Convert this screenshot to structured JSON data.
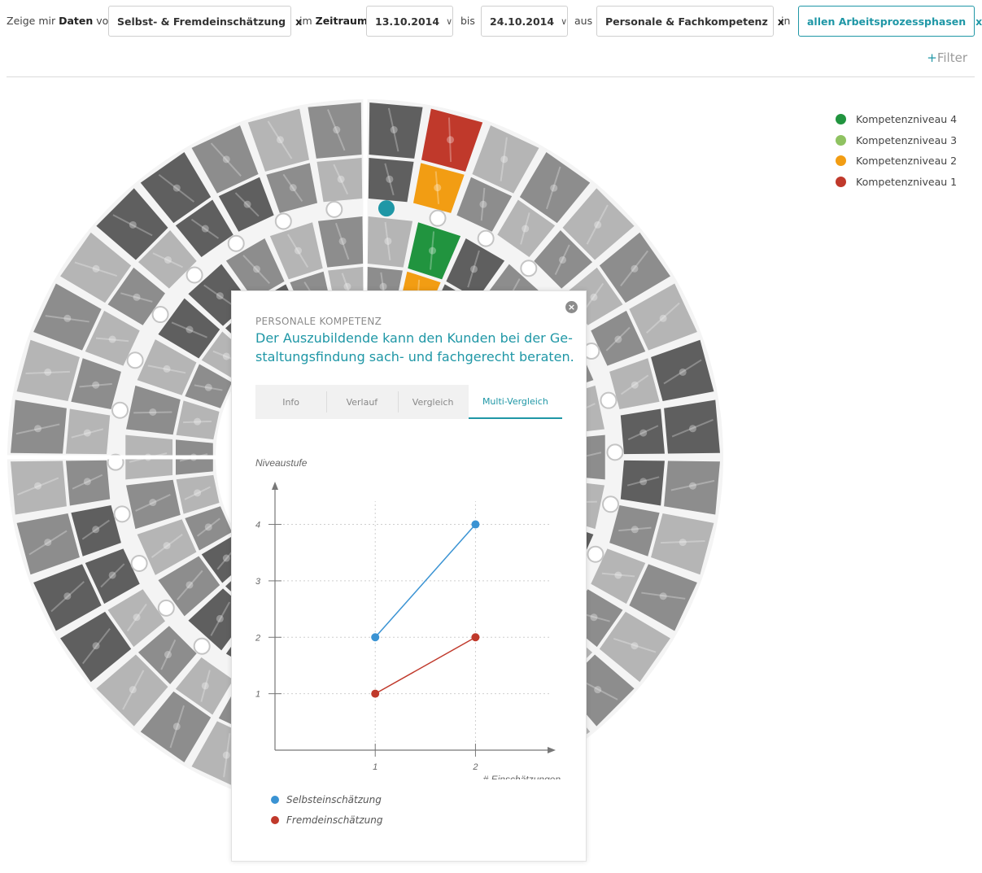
{
  "filter": {
    "prefix": "Zeige mir",
    "daten": "Daten",
    "von": "von",
    "source_value": "Selbst- & Fremdeinschätzung",
    "im": "im",
    "zeitraum": "Zeitraum",
    "date_from": "13.10.2014",
    "bis": "bis",
    "date_to": "24.10.2014",
    "aus": "aus",
    "competence_value": "Personale & Fachkompetenz",
    "in": "in",
    "phase_value": "allen Arbeitsprozessphasen",
    "remove": "x",
    "add_filter": "Filter",
    "add_plus": "+"
  },
  "legend": {
    "items": [
      {
        "label": "Kompetenzniveau 4",
        "color": "#21943f"
      },
      {
        "label": "Kompetenzniveau 3",
        "color": "#8fc261"
      },
      {
        "label": "Kompetenzniveau 2",
        "color": "#f29d13"
      },
      {
        "label": "Kompetenzniveau 1",
        "color": "#c0392b"
      }
    ]
  },
  "wheel": {
    "colors": {
      "dark": "#5f5f5f",
      "mid": "#8d8d8d",
      "light": "#b5b5b5",
      "ring_bg": "#ececec",
      "teal": "#1f97a6"
    }
  },
  "popup": {
    "category": "PERSONALE KOMPETENZ",
    "title": "Der Auszubildende kann den Kunden bei der Ge-staltungsfindung sach- und fachgerecht beraten.",
    "close_label": "×",
    "tabs": [
      {
        "label": "Info",
        "active": false
      },
      {
        "label": "Verlauf",
        "active": false
      },
      {
        "label": "Vergleich",
        "active": false
      },
      {
        "label": "Multi-Vergleich",
        "active": true
      }
    ]
  },
  "chart_data": {
    "type": "line",
    "ylabel": "Niveaustufe",
    "xlabel": "# Einschätzungen",
    "x": [
      1,
      2
    ],
    "x_ticks": [
      "1",
      "2"
    ],
    "y_ticks": [
      "1",
      "2",
      "3",
      "4"
    ],
    "xlim": [
      0,
      2.8
    ],
    "ylim": [
      0,
      4.7
    ],
    "grid": true,
    "legend_position": "bottom-left",
    "series": [
      {
        "name": "Selbsteinschätzung",
        "values": [
          2,
          4
        ],
        "color": "#3a93d3"
      },
      {
        "name": "Fremdeinschätzung",
        "values": [
          1,
          2
        ],
        "color": "#c0392b"
      }
    ]
  }
}
